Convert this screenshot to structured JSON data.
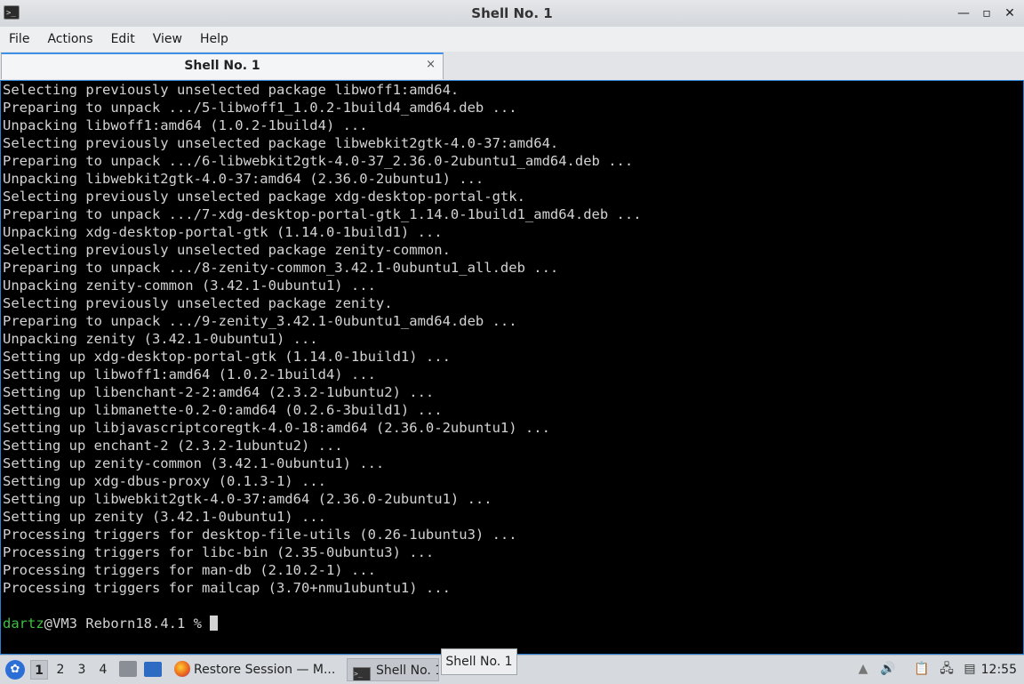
{
  "window": {
    "title": "Shell No. 1",
    "controls": [
      "minimize-icon",
      "maximize-icon",
      "close-icon"
    ]
  },
  "menu": [
    "File",
    "Actions",
    "Edit",
    "View",
    "Help"
  ],
  "tab": {
    "label": "Shell No. 1",
    "close_glyph": "×"
  },
  "terminal": {
    "lines": [
      "Selecting previously unselected package libwoff1:amd64.",
      "Preparing to unpack .../5-libwoff1_1.0.2-1build4_amd64.deb ...",
      "Unpacking libwoff1:amd64 (1.0.2-1build4) ...",
      "Selecting previously unselected package libwebkit2gtk-4.0-37:amd64.",
      "Preparing to unpack .../6-libwebkit2gtk-4.0-37_2.36.0-2ubuntu1_amd64.deb ...",
      "Unpacking libwebkit2gtk-4.0-37:amd64 (2.36.0-2ubuntu1) ...",
      "Selecting previously unselected package xdg-desktop-portal-gtk.",
      "Preparing to unpack .../7-xdg-desktop-portal-gtk_1.14.0-1build1_amd64.deb ...",
      "Unpacking xdg-desktop-portal-gtk (1.14.0-1build1) ...",
      "Selecting previously unselected package zenity-common.",
      "Preparing to unpack .../8-zenity-common_3.42.1-0ubuntu1_all.deb ...",
      "Unpacking zenity-common (3.42.1-0ubuntu1) ...",
      "Selecting previously unselected package zenity.",
      "Preparing to unpack .../9-zenity_3.42.1-0ubuntu1_amd64.deb ...",
      "Unpacking zenity (3.42.1-0ubuntu1) ...",
      "Setting up xdg-desktop-portal-gtk (1.14.0-1build1) ...",
      "Setting up libwoff1:amd64 (1.0.2-1build4) ...",
      "Setting up libenchant-2-2:amd64 (2.3.2-1ubuntu2) ...",
      "Setting up libmanette-0.2-0:amd64 (0.2.6-3build1) ...",
      "Setting up libjavascriptcoregtk-4.0-18:amd64 (2.36.0-2ubuntu1) ...",
      "Setting up enchant-2 (2.3.2-1ubuntu2) ...",
      "Setting up zenity-common (3.42.1-0ubuntu1) ...",
      "Setting up xdg-dbus-proxy (0.1.3-1) ...",
      "Setting up libwebkit2gtk-4.0-37:amd64 (2.36.0-2ubuntu1) ...",
      "Setting up zenity (3.42.1-0ubuntu1) ...",
      "Processing triggers for desktop-file-utils (0.26-1ubuntu3) ...",
      "Processing triggers for libc-bin (2.35-0ubuntu3) ...",
      "Processing triggers for man-db (2.10.2-1) ...",
      "Processing triggers for mailcap (3.70+nmu1ubuntu1) ...",
      ""
    ],
    "prompt_user": "dartz",
    "prompt_rest": "@VM3 Reborn18.4.1 % ",
    "colors": {
      "background": "#000000",
      "text": "#d3d3d3",
      "user": "#3fbf3f",
      "focus_border": "#2a7fd4"
    }
  },
  "taskbar": {
    "workspaces": [
      "1",
      "2",
      "3",
      "4"
    ],
    "active_workspace": "1",
    "tasks": [
      {
        "label": "Restore Session — M...",
        "icon": "firefox-icon"
      },
      {
        "label": "Shell No. 1",
        "icon": "terminal-icon"
      }
    ],
    "tooltip": "Shell No. 1",
    "clock": "12:55"
  }
}
